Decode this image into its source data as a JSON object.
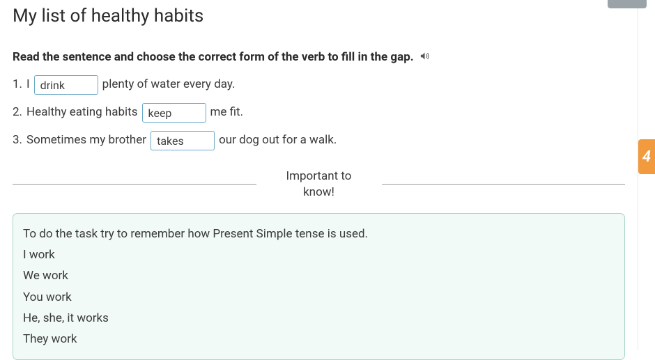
{
  "title": "My list of healthy habits",
  "instruction": "Read the sentence and choose the correct form of the verb to fill in the gap.",
  "sentences": [
    {
      "num": "1.",
      "before": "I",
      "value": "drink",
      "after": "plenty of water every day."
    },
    {
      "num": "2.",
      "before": "Healthy eating habits",
      "value": "keep",
      "after": "me fit."
    },
    {
      "num": "3.",
      "before": "Sometimes my brother",
      "value": "takes",
      "after": "our dog out for a walk."
    }
  ],
  "divider_label": "Important to know!",
  "hint": {
    "intro": "To do the task try to remember how Present Simple tense is used.",
    "lines": [
      "I work",
      "We work",
      "You work",
      "He, she, it works",
      "They work"
    ]
  },
  "side_badge": "4"
}
